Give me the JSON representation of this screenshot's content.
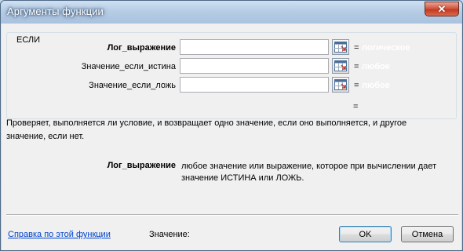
{
  "window": {
    "title": "Аргументы функции",
    "close_icon": "close-icon"
  },
  "function": {
    "name": "ЕСЛИ",
    "args": [
      {
        "label": "Лог_выражение",
        "value": "",
        "result_preview": "логическое"
      },
      {
        "label": "Значение_если_истина",
        "value": "",
        "result_preview": "любое"
      },
      {
        "label": "Значение_если_ложь",
        "value": "",
        "result_preview": "любое"
      }
    ],
    "equals_sign": "=",
    "description": "Проверяет, выполняется ли условие, и возвращает одно значение, если оно выполняется, и другое значение, если нет.",
    "arg_help": {
      "name": "Лог_выражение",
      "text": "любое значение или выражение, которое при вычислении дает значение ИСТИНА или ЛОЖЬ."
    }
  },
  "footer": {
    "help_link": "Справка по этой функции",
    "result_label": "Значение:",
    "ok_label": "OK",
    "cancel_label": "Отмена"
  },
  "colors": {
    "title_bar": "#b7cde5",
    "close_button": "#c23a22",
    "link": "#0044cc"
  }
}
